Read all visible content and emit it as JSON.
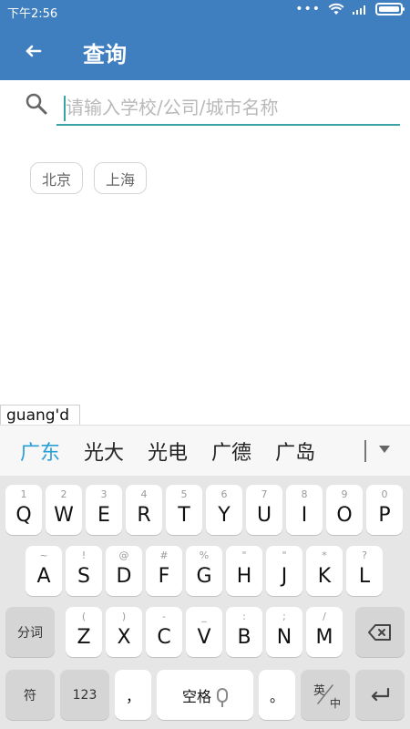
{
  "status_bar": {
    "time": "下午2:56",
    "dots": "•••"
  },
  "app_bar": {
    "title": "查询",
    "back_icon": "back-arrow-icon"
  },
  "search": {
    "placeholder": "请输入学校/公司/城市名称",
    "icon": "search-icon"
  },
  "hot_cities": [
    {
      "label": "北京"
    },
    {
      "label": "上海"
    }
  ],
  "ime": {
    "composing": "guang'd",
    "candidates": [
      "广东",
      "光大",
      "光电",
      "广德",
      "广岛"
    ],
    "selected_candidate": "广东"
  },
  "keyboard": {
    "row1": [
      {
        "sub": "1",
        "main": "Q"
      },
      {
        "sub": "2",
        "main": "W"
      },
      {
        "sub": "3",
        "main": "E"
      },
      {
        "sub": "4",
        "main": "R"
      },
      {
        "sub": "5",
        "main": "T"
      },
      {
        "sub": "6",
        "main": "Y"
      },
      {
        "sub": "7",
        "main": "U"
      },
      {
        "sub": "8",
        "main": "I"
      },
      {
        "sub": "9",
        "main": "O"
      },
      {
        "sub": "0",
        "main": "P"
      }
    ],
    "row2": [
      {
        "sub": "~",
        "main": "A"
      },
      {
        "sub": "!",
        "main": "S"
      },
      {
        "sub": "@",
        "main": "D"
      },
      {
        "sub": "#",
        "main": "F"
      },
      {
        "sub": "%",
        "main": "G"
      },
      {
        "sub": "\"",
        "main": "H"
      },
      {
        "sub": "\"",
        "main": "J"
      },
      {
        "sub": "*",
        "main": "K"
      },
      {
        "sub": "?",
        "main": "L"
      }
    ],
    "row3": [
      {
        "sub": "(",
        "main": "Z"
      },
      {
        "sub": ")",
        "main": "X"
      },
      {
        "sub": "-",
        "main": "C"
      },
      {
        "sub": "_",
        "main": "V"
      },
      {
        "sub": ":",
        "main": "B"
      },
      {
        "sub": ";",
        "main": "N"
      },
      {
        "sub": "/",
        "main": "M"
      }
    ],
    "fenci_label": "分词",
    "row4": {
      "symbols_label": "符",
      "numbers_label": "123",
      "comma_label": "，",
      "space_label": "空格",
      "period_label": "。",
      "lang_toggle_top": "英",
      "lang_toggle_bottom": "中"
    }
  }
}
